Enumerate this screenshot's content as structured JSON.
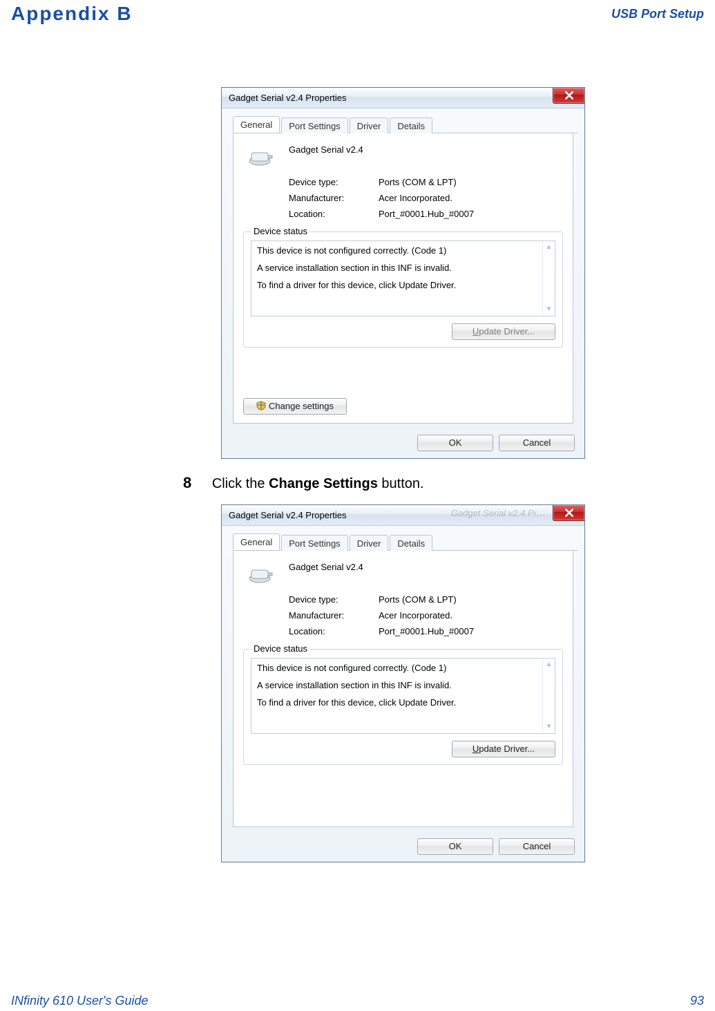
{
  "header": {
    "left": "Appendix B",
    "right": "USB Port Setup"
  },
  "footer": {
    "left": "INfinity 610 User's Guide",
    "page": "93"
  },
  "step": {
    "number": "8",
    "before_bold": "Click the ",
    "bold": "Change Settings",
    "after_bold": " button."
  },
  "dialog1": {
    "title": "Gadget Serial v2.4 Properties",
    "faint_behind": "",
    "tabs": [
      "General",
      "Port Settings",
      "Driver",
      "Details"
    ],
    "active_tab_index": 0,
    "device_name": "Gadget Serial v2.4",
    "rows": {
      "device_type_k": "Device type:",
      "device_type_v": "Ports (COM & LPT)",
      "manufacturer_k": "Manufacturer:",
      "manufacturer_v": "Acer Incorporated.",
      "location_k": "Location:",
      "location_v": "Port_#0001.Hub_#0007"
    },
    "status_legend": "Device status",
    "status_lines": {
      "l1": "This device is not configured correctly. (Code 1)",
      "l2": "A service installation section in this INF is invalid.",
      "l3": "To find a driver for this device, click Update Driver."
    },
    "update_prefix": "U",
    "update_rest": "pdate Driver...",
    "change_settings": "Change settings",
    "ok": "OK",
    "cancel": "Cancel",
    "show_change_settings": true,
    "show_faint": false
  },
  "dialog2": {
    "title": "Gadget Serial v2.4 Properties",
    "faint_behind": "Gadget Serial v2.4 Pr…",
    "tabs": [
      "General",
      "Port Settings",
      "Driver",
      "Details"
    ],
    "active_tab_index": 0,
    "device_name": "Gadget Serial v2.4",
    "rows": {
      "device_type_k": "Device type:",
      "device_type_v": "Ports (COM & LPT)",
      "manufacturer_k": "Manufacturer:",
      "manufacturer_v": "Acer Incorporated.",
      "location_k": "Location:",
      "location_v": "Port_#0001.Hub_#0007"
    },
    "status_legend": "Device status",
    "status_lines": {
      "l1": "This device is not configured correctly. (Code 1)",
      "l2": "A service installation section in this INF is invalid.",
      "l3": "To find a driver for this device, click Update Driver."
    },
    "update_prefix": "U",
    "update_rest": "pdate Driver...",
    "ok": "OK",
    "cancel": "Cancel",
    "show_change_settings": false,
    "show_faint": true
  }
}
